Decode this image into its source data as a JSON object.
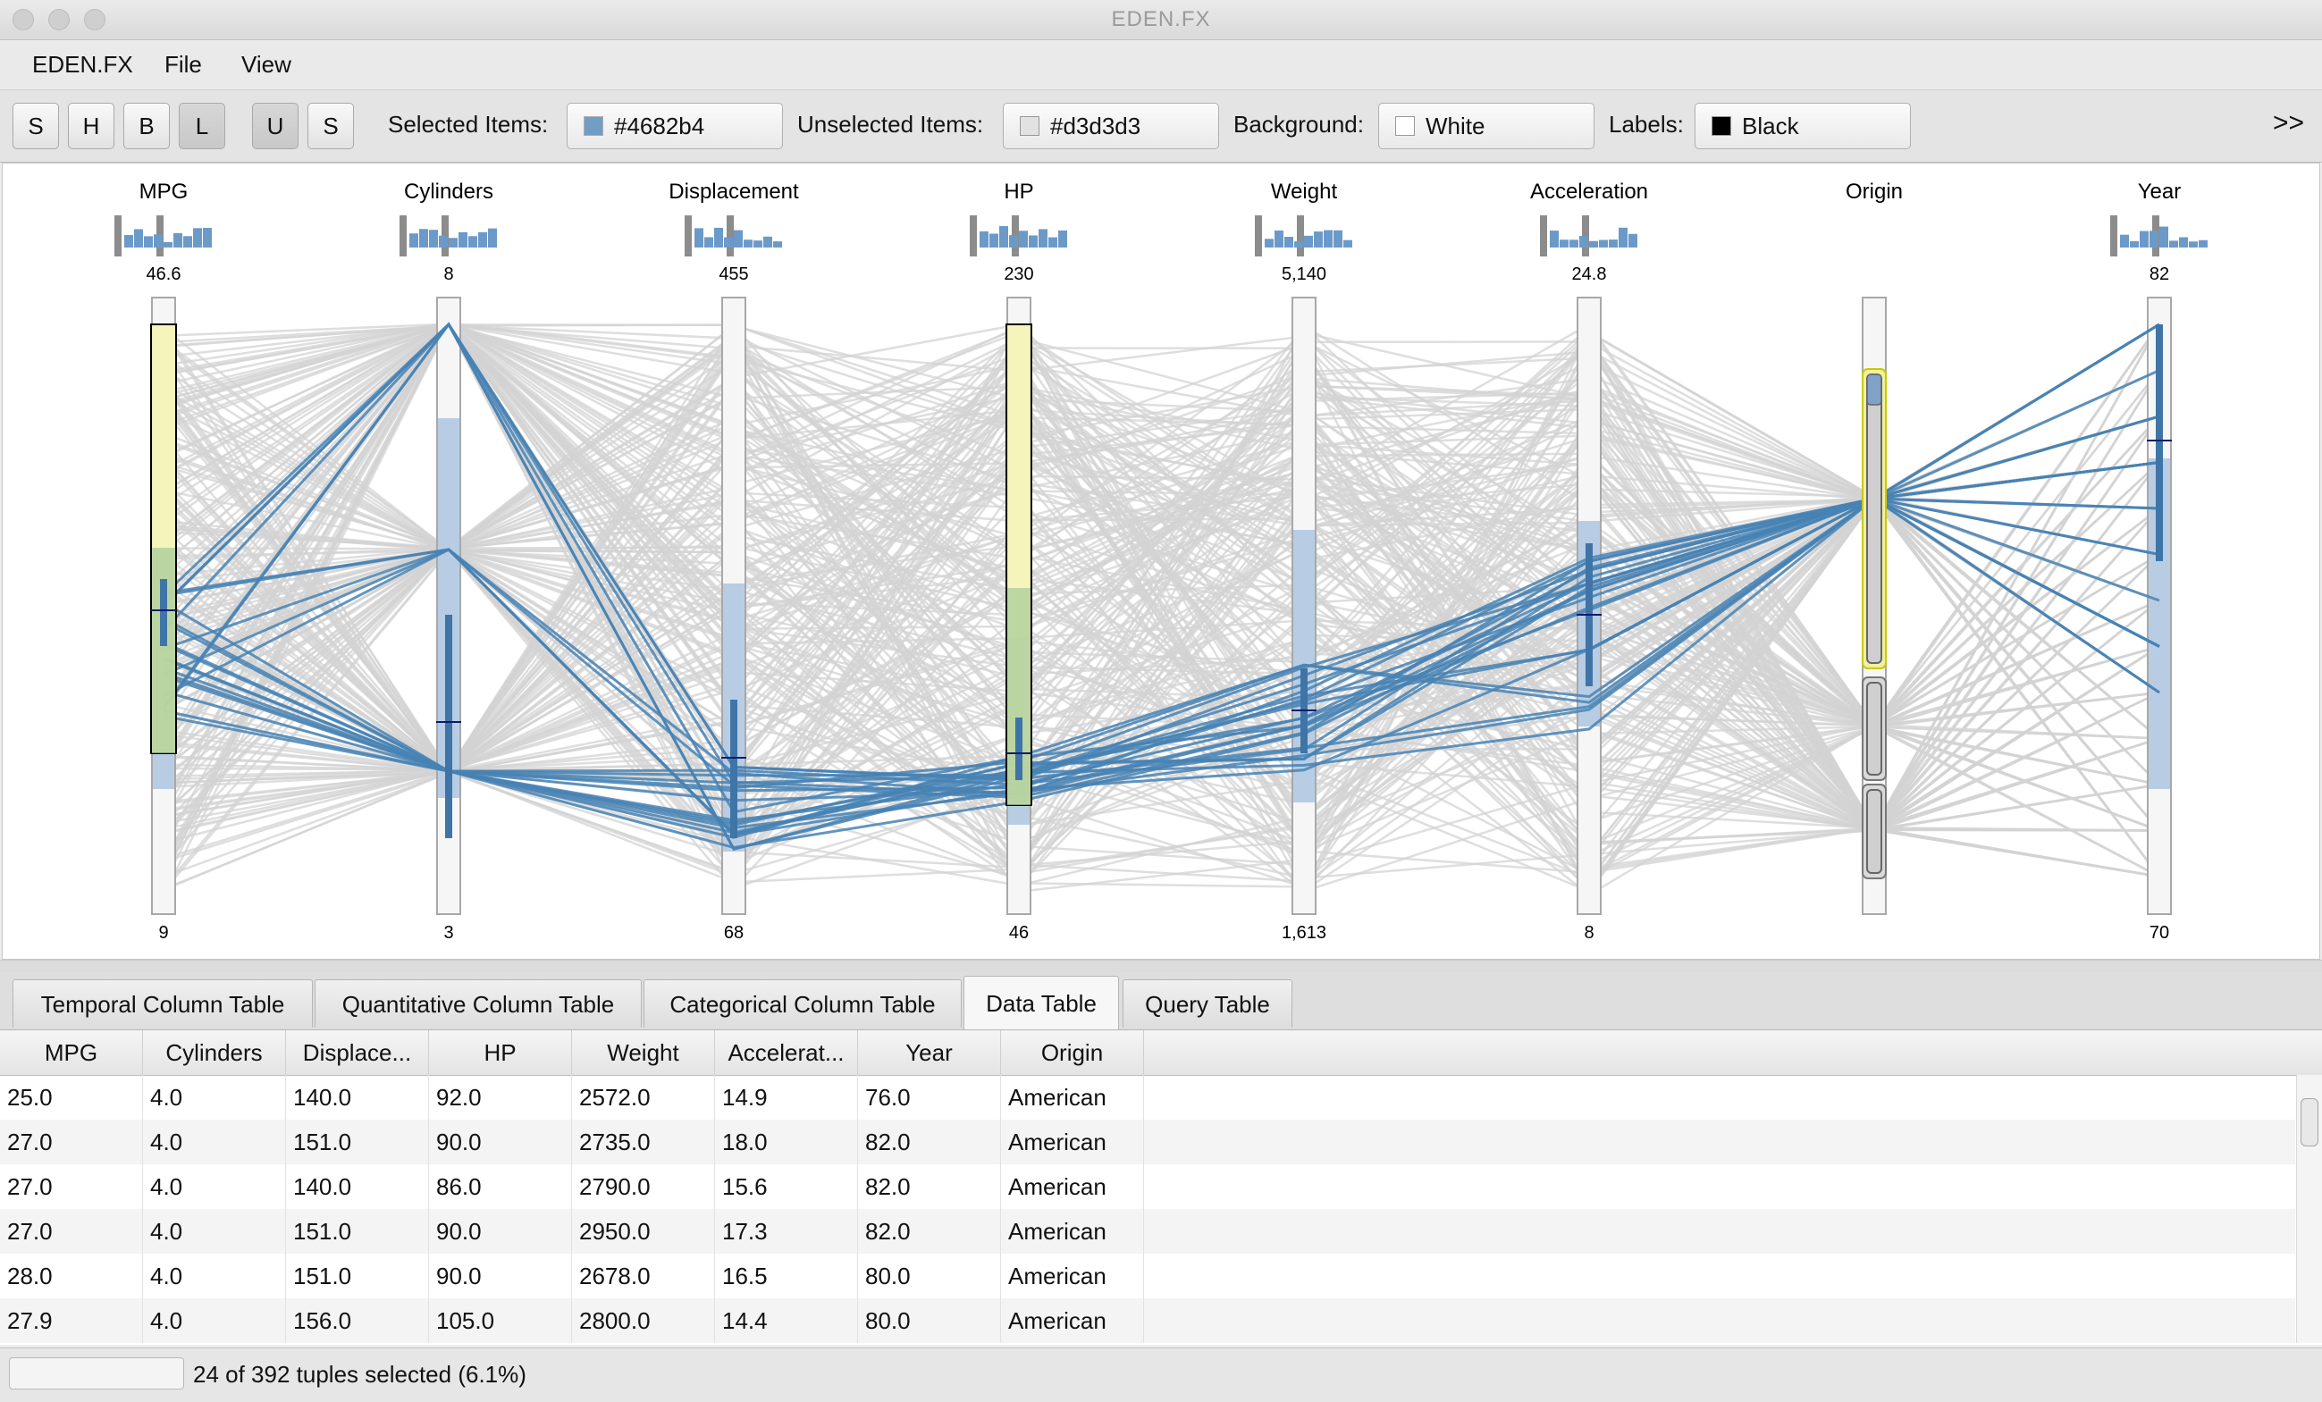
{
  "window": {
    "title": "EDEN.FX"
  },
  "menu": [
    "EDEN.FX",
    "File",
    "View"
  ],
  "toolbar": {
    "buttons": [
      "S",
      "H",
      "B",
      "L",
      "U",
      "S"
    ],
    "selected_label": "Selected Items:",
    "selected_color": "#4682b4",
    "unselected_label": "Unselected Items:",
    "unselected_color": "#d3d3d3",
    "background_label": "Background:",
    "background_value": "White",
    "labels_label": "Labels:",
    "labels_value": "Black",
    "overflow": ">>"
  },
  "plot": {
    "axes": [
      {
        "name": "MPG",
        "max": "46.6",
        "min": "9"
      },
      {
        "name": "Cylinders",
        "max": "8",
        "min": "3"
      },
      {
        "name": "Displacement",
        "max": "455",
        "min": "68"
      },
      {
        "name": "HP",
        "max": "230",
        "min": "46"
      },
      {
        "name": "Weight",
        "max": "5,140",
        "min": "1,613"
      },
      {
        "name": "Acceleration",
        "max": "24.8",
        "min": "8"
      },
      {
        "name": "Origin",
        "max": "",
        "min": ""
      },
      {
        "name": "Year",
        "max": "82",
        "min": "70"
      }
    ]
  },
  "tabs": [
    "Temporal Column Table",
    "Quantitative Column Table",
    "Categorical Column Table",
    "Data Table",
    "Query Table"
  ],
  "active_tab": "Data Table",
  "table": {
    "columns": [
      "MPG",
      "Cylinders",
      "Displace...",
      "HP",
      "Weight",
      "Accelerat...",
      "Year",
      "Origin"
    ],
    "rows": [
      [
        "25.0",
        "4.0",
        "140.0",
        "92.0",
        "2572.0",
        "14.9",
        "76.0",
        "American"
      ],
      [
        "27.0",
        "4.0",
        "151.0",
        "90.0",
        "2735.0",
        "18.0",
        "82.0",
        "American"
      ],
      [
        "27.0",
        "4.0",
        "140.0",
        "86.0",
        "2790.0",
        "15.6",
        "82.0",
        "American"
      ],
      [
        "27.0",
        "4.0",
        "151.0",
        "90.0",
        "2950.0",
        "17.3",
        "82.0",
        "American"
      ],
      [
        "28.0",
        "4.0",
        "151.0",
        "90.0",
        "2678.0",
        "16.5",
        "80.0",
        "American"
      ],
      [
        "27.9",
        "4.0",
        "156.0",
        "105.0",
        "2800.0",
        "14.4",
        "80.0",
        "American"
      ]
    ]
  },
  "status": {
    "text": "24 of 392 tuples selected (6.1%)"
  }
}
